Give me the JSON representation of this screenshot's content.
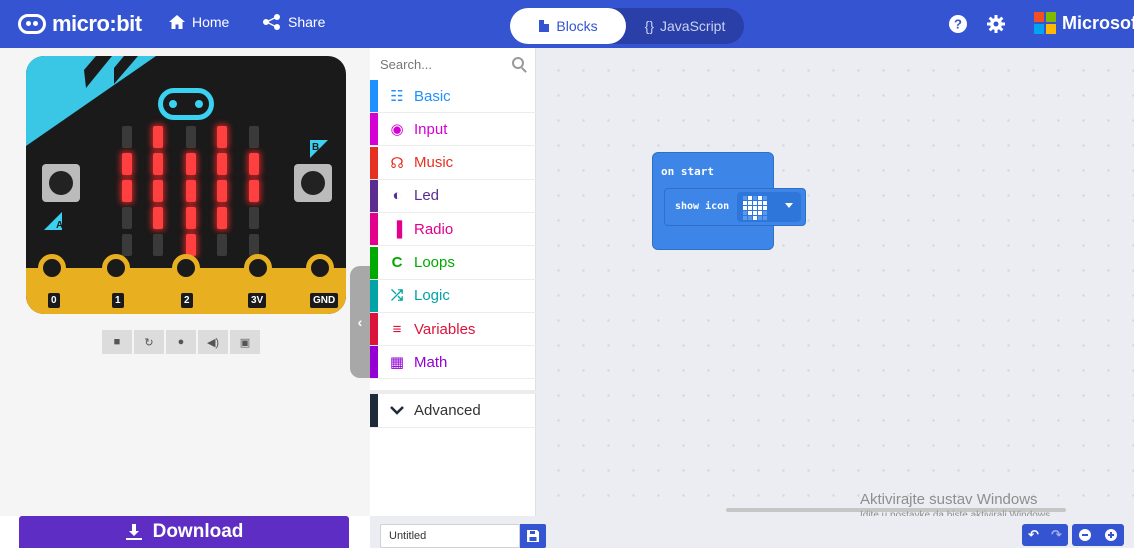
{
  "header": {
    "logo_text": "micro:bit",
    "home_label": "Home",
    "share_label": "Share",
    "blocks_label": "Blocks",
    "javascript_label": "JavaScript",
    "microsoft_label": "Microsoft"
  },
  "simulator": {
    "pins": [
      "0",
      "1",
      "2",
      "3V",
      "GND"
    ],
    "button_a": "A",
    "button_b": "B",
    "led_matrix": [
      [
        0,
        1,
        0,
        1,
        0
      ],
      [
        1,
        1,
        1,
        1,
        1
      ],
      [
        1,
        1,
        1,
        1,
        1
      ],
      [
        0,
        1,
        1,
        1,
        0
      ],
      [
        0,
        0,
        1,
        0,
        0
      ]
    ],
    "download_label": "Download"
  },
  "toolbox": {
    "search_placeholder": "Search...",
    "categories": [
      {
        "label": "Basic",
        "color": "#1e90ff",
        "icon": "grid-icon"
      },
      {
        "label": "Input",
        "color": "#d400d4",
        "icon": "target-icon"
      },
      {
        "label": "Music",
        "color": "#e63022",
        "icon": "headphones-icon"
      },
      {
        "label": "Led",
        "color": "#5c2d91",
        "icon": "toggle-icon"
      },
      {
        "label": "Radio",
        "color": "#e3008c",
        "icon": "signal-icon"
      },
      {
        "label": "Loops",
        "color": "#00aa00",
        "icon": "loop-icon"
      },
      {
        "label": "Logic",
        "color": "#00a4a6",
        "icon": "shuffle-icon"
      },
      {
        "label": "Variables",
        "color": "#dc143c",
        "icon": "lines-icon"
      },
      {
        "label": "Math",
        "color": "#9400d3",
        "icon": "calculator-icon"
      }
    ],
    "advanced_label": "Advanced"
  },
  "workspace": {
    "on_start_label": "on start",
    "show_icon_label": "show icon",
    "block_color": "#3d86e8",
    "watermark_line1": "Aktivirajte sustav Windows",
    "watermark_line2": "Idite u postavke da biste aktivirali Windows."
  },
  "bottom": {
    "project_name": "Untitled"
  }
}
